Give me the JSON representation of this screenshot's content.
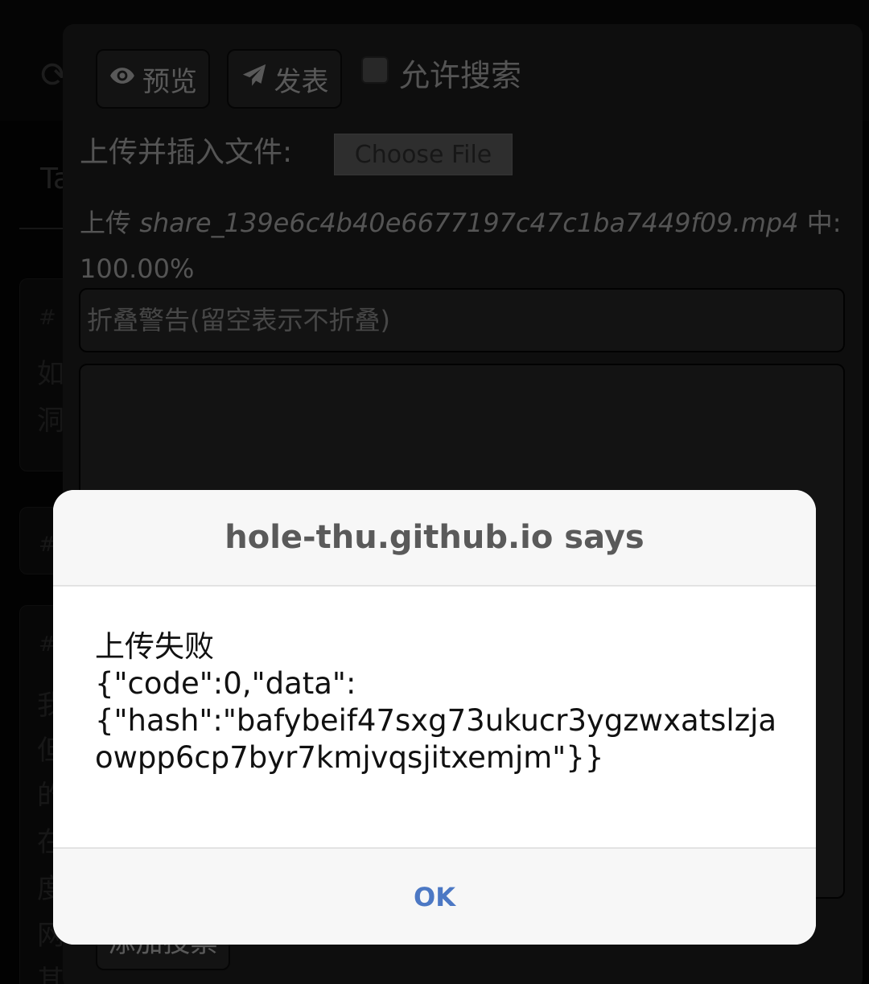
{
  "background": {
    "tabs_label": "Ta",
    "refresh_glyph": "⟳",
    "card_text_fragments": [
      "#",
      "如",
      "洞",
      "#",
      "#",
      "我",
      "但",
      "的",
      "在",
      "度",
      "网",
      "其"
    ]
  },
  "editor": {
    "preview_label": "预览",
    "post_label": "发表",
    "allow_search_label": "允许搜索",
    "allow_search_checked": false,
    "upload_label": "上传并插入文件:",
    "choose_file_label": "Choose File",
    "upload_prefix": "上传",
    "upload_filename": "share_139e6c4b40e6677197c47c1ba7449f09.mp4",
    "upload_suffix": "中:",
    "upload_progress": "100.00%",
    "fold_warning_placeholder": "折叠警告(留空表示不折叠)",
    "add_tag_label": "添加投票"
  },
  "alert": {
    "title": "hole-thu.github.io says",
    "message_lines": [
      "上传失败",
      "{\"code\":0,\"data\":",
      "{\"hash\":\"bafybeif47sxg73ukucr3ygzwxatslzja",
      "owpp6cp7byr7kmjvqsjitxemjm\"}}"
    ],
    "ok_label": "OK"
  },
  "colors": {
    "accent": "#4c78c4",
    "panel": "#1d1d1d",
    "dialog": "#ffffff"
  }
}
